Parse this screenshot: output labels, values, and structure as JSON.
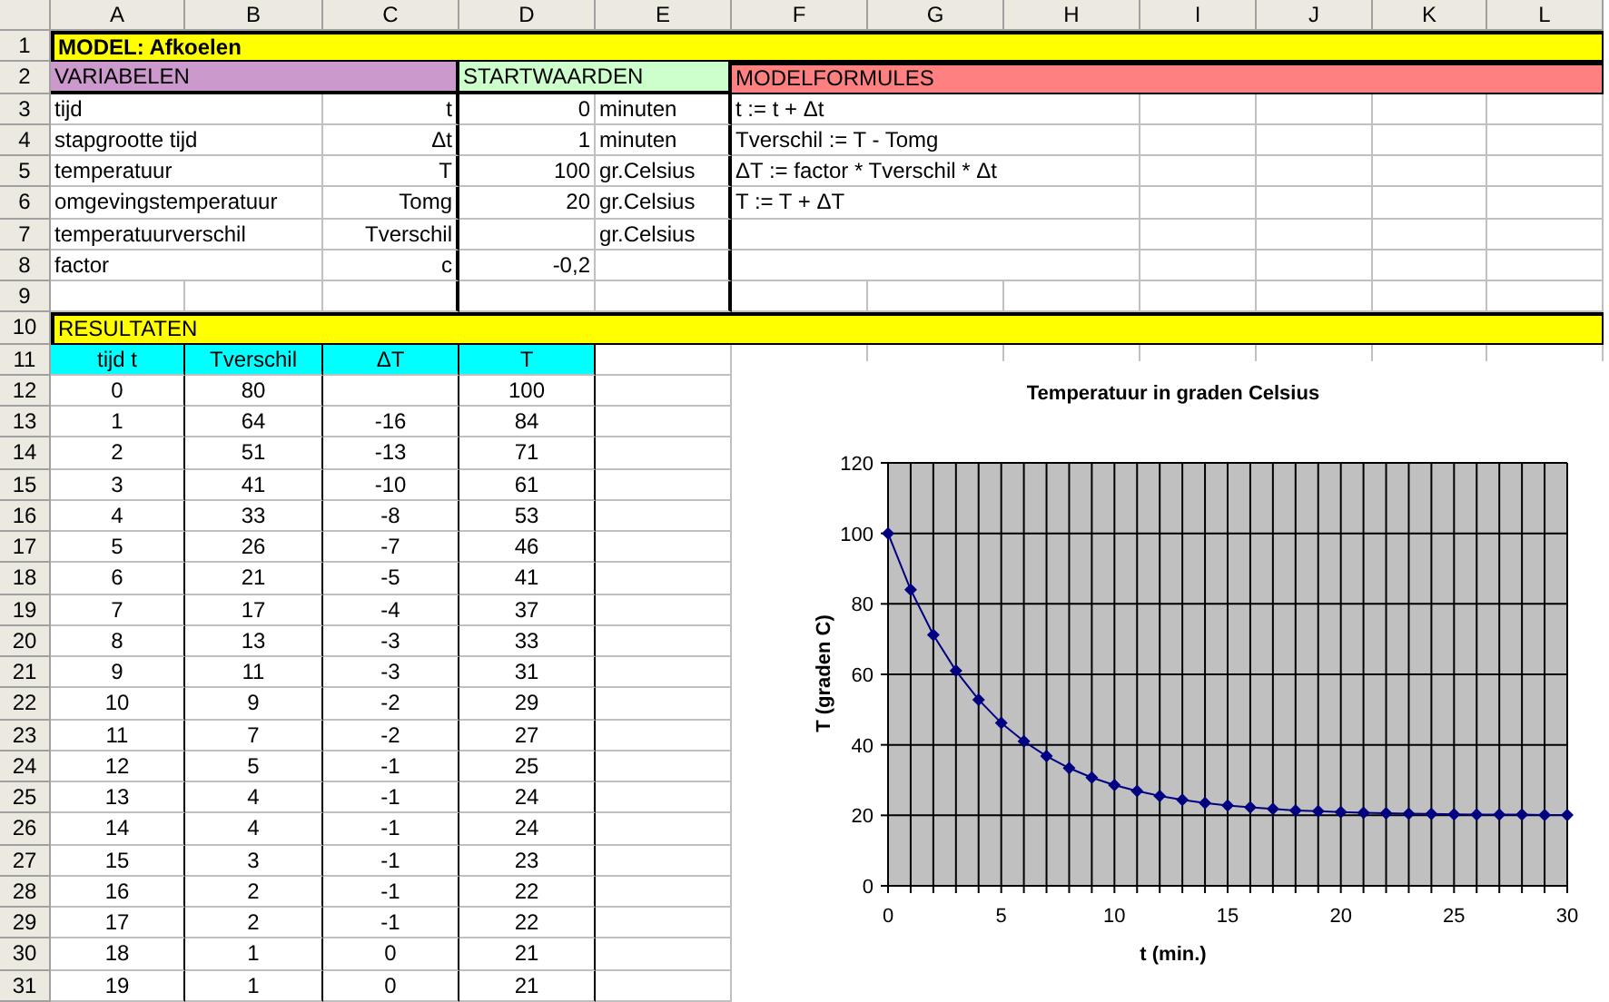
{
  "columns": [
    "A",
    "B",
    "C",
    "D",
    "E",
    "F",
    "G",
    "H",
    "I",
    "J",
    "K",
    "L"
  ],
  "row_numbers": [
    "1",
    "2",
    "3",
    "4",
    "5",
    "6",
    "7",
    "8",
    "9",
    "10",
    "11",
    "12",
    "13",
    "14",
    "15",
    "16",
    "17",
    "18",
    "19",
    "20",
    "21",
    "22",
    "23",
    "24",
    "25",
    "26",
    "27",
    "28",
    "29",
    "30",
    "31"
  ],
  "title": "MODEL: Afkoelen",
  "sections": {
    "variables": "VARIABELEN",
    "start_values": "STARTWAARDEN",
    "formulas": "MODELFORMULES",
    "results": "RESULTATEN"
  },
  "variables": [
    {
      "name": "tijd",
      "symbol": "t",
      "value": "0",
      "unit": "minuten",
      "formula": "t := t + Δt"
    },
    {
      "name": "stapgrootte tijd",
      "symbol": "Δt",
      "value": "1",
      "unit": "minuten",
      "formula": "Tverschil := T - Tomg"
    },
    {
      "name": "temperatuur",
      "symbol": "T",
      "value": "100",
      "unit": "gr.Celsius",
      "formula": "ΔT := factor * Tverschil * Δt"
    },
    {
      "name": "omgevingstemperatuur",
      "symbol": "Tomg",
      "value": "20",
      "unit": "gr.Celsius",
      "formula": "T := T + ΔT"
    },
    {
      "name": "temperatuurverschil",
      "symbol": "Tverschil",
      "unit": "gr.Celsius"
    },
    {
      "name": "factor",
      "symbol": "c",
      "value": "-0,2"
    }
  ],
  "results": {
    "columns": [
      "tijd t",
      "Tverschil",
      "ΔT",
      "T"
    ],
    "rows": [
      [
        "0",
        "80",
        null,
        "100"
      ],
      [
        "1",
        "64",
        "-16",
        "84"
      ],
      [
        "2",
        "51",
        "-13",
        "71"
      ],
      [
        "3",
        "41",
        "-10",
        "61"
      ],
      [
        "4",
        "33",
        "-8",
        "53"
      ],
      [
        "5",
        "26",
        "-7",
        "46"
      ],
      [
        "6",
        "21",
        "-5",
        "41"
      ],
      [
        "7",
        "17",
        "-4",
        "37"
      ],
      [
        "8",
        "13",
        "-3",
        "33"
      ],
      [
        "9",
        "11",
        "-3",
        "31"
      ],
      [
        "10",
        "9",
        "-2",
        "29"
      ],
      [
        "11",
        "7",
        "-2",
        "27"
      ],
      [
        "12",
        "5",
        "-1",
        "25"
      ],
      [
        "13",
        "4",
        "-1",
        "24"
      ],
      [
        "14",
        "4",
        "-1",
        "24"
      ],
      [
        "15",
        "3",
        "-1",
        "23"
      ],
      [
        "16",
        "2",
        "-1",
        "22"
      ],
      [
        "17",
        "2",
        "-1",
        "22"
      ],
      [
        "18",
        "1",
        "0",
        "21"
      ],
      [
        "19",
        "1",
        "0",
        "21"
      ]
    ]
  },
  "chart": {
    "chart_data": {
      "type": "line",
      "title": "Temperatuur in graden Celsius",
      "xlabel": "t (min.)",
      "ylabel": "T (graden C)",
      "x": [
        0,
        1,
        2,
        3,
        4,
        5,
        6,
        7,
        8,
        9,
        10,
        11,
        12,
        13,
        14,
        15,
        16,
        17,
        18,
        19,
        20,
        21,
        22,
        23,
        24,
        25,
        26,
        27,
        28,
        29,
        30
      ],
      "grid": true,
      "series": [
        {
          "color": "#000080",
          "marker": "diamond",
          "values": [
            100,
            84,
            71.2,
            61,
            52.8,
            46.2,
            41,
            36.8,
            33.4,
            30.7,
            28.6,
            26.9,
            25.5,
            24.4,
            23.5,
            22.8,
            22.3,
            21.8,
            21.4,
            21.2,
            20.9,
            20.7,
            20.6,
            20.5,
            20.4,
            20.3,
            20.2,
            20.2,
            20.2,
            20.1,
            20.1
          ]
        }
      ],
      "xlim": [
        0,
        30
      ],
      "ylim": [
        0,
        120
      ],
      "xticks": [
        0,
        5,
        10,
        15,
        20,
        25,
        30
      ],
      "yticks": [
        0,
        20,
        40,
        60,
        80,
        100,
        120
      ]
    }
  }
}
